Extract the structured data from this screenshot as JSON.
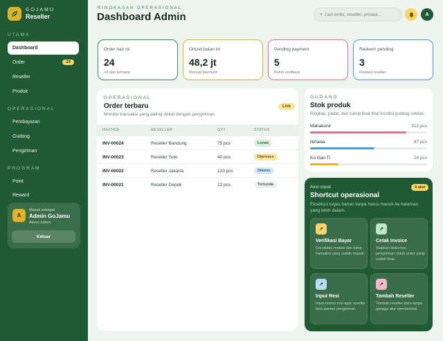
{
  "brand": {
    "top": "GOJAMU",
    "bottom": "Reseller"
  },
  "sidebar": {
    "sections": [
      {
        "label": "UTAMA"
      },
      {
        "label": "OPERASIONAL"
      },
      {
        "label": "PROGRAM"
      }
    ],
    "items": [
      {
        "label": "Dashboard"
      },
      {
        "label": "Order",
        "badge": "24"
      },
      {
        "label": "Reseller"
      },
      {
        "label": "Produk"
      },
      {
        "label": "Pembayaran"
      },
      {
        "label": "Gudang"
      },
      {
        "label": "Pengiriman"
      },
      {
        "label": "Point"
      },
      {
        "label": "Reward"
      }
    ],
    "user": {
      "caption": "Masuk sebagai",
      "name": "Admin GoJamu",
      "role": "Akses admin",
      "initial": "A",
      "logout": "Keluar"
    }
  },
  "header": {
    "eyebrow": "RINGKASAN OPERASIONAL",
    "title": "Dashboard Admin",
    "search_placeholder": "Cari order, reseller, produk...",
    "avatar_initial": "A"
  },
  "stats": [
    {
      "label": "Order hari ini",
      "value": "24",
      "note": "+8 dari kemarin",
      "color": "#3d8a58"
    },
    {
      "label": "Omzet bulan ini",
      "value": "48,2 jt",
      "note": "Manual payment",
      "color": "#e0b42a"
    },
    {
      "label": "Pending payment",
      "value": "5",
      "note": "Butuh verifikasi",
      "color": "#d9748f"
    },
    {
      "label": "Redeem pending",
      "value": "3",
      "note": "Reward reseller",
      "color": "#4a9bd1"
    }
  ],
  "orders": {
    "eyebrow": "OPERASIONAL",
    "title": "Order terbaru",
    "subtitle": "Monitor transaksi yang paling dekat dengan pengiriman.",
    "badge": "Live",
    "columns": [
      "INVOICE",
      "RESELLER",
      "QTY",
      "STATUS"
    ],
    "rows": [
      {
        "invoice": "INV-00024",
        "reseller": "Reseller Bandung",
        "qty": "75 pcs",
        "status": "Lunas",
        "bg": "#d6efdc",
        "fg": "#2b6a3f"
      },
      {
        "invoice": "INV-00023",
        "reseller": "Reseller Solo",
        "qty": "40 pcs",
        "status": "Diproses",
        "bg": "#f8e6a3",
        "fg": "#6b5208"
      },
      {
        "invoice": "INV-00022",
        "reseller": "Reseller Jakarta",
        "qty": "120 pcs",
        "status": "Dikirim",
        "bg": "#d6e9f8",
        "fg": "#1f5a85"
      },
      {
        "invoice": "INV-00021",
        "reseller": "Reseller Depok",
        "qty": "12 pcs",
        "status": "Tertunda",
        "bg": "#edf0ee",
        "fg": "#4b5850"
      }
    ]
  },
  "stock": {
    "eyebrow": "GUDANG",
    "title": "Stok produk",
    "subtitle": "Ringkas, padat, dan cukup buat lihat kondisi gudang sekilas.",
    "items": [
      {
        "name": "Mahakunir",
        "qty": "312 pcs",
        "level": 0.82,
        "color": "#d9748f"
      },
      {
        "name": "Nirlawa",
        "qty": "87 pcs",
        "level": 0.55,
        "color": "#4a9bd1"
      },
      {
        "name": "Ko Gan Ti",
        "qty": "24 pcs",
        "level": 0.24,
        "color": "#e0b42a"
      }
    ]
  },
  "shortcuts": {
    "eyebrow": "Aksi cepat",
    "badge": "4 aksi",
    "title": "Shortcut operasional",
    "subtitle": "Eksekusi tugas harian tanpa harus masuk ke halaman yang lebih dalam.",
    "tiles": [
      {
        "title": "Verifikasi Bayar",
        "desc": "Cocokkan mutasi dan tutup transaksi yang sudah masuk.",
        "color": "#f6d56a"
      },
      {
        "title": "Cetak Invoice",
        "desc": "Siapkan dokumen pengiriman untuk order yang sudah final.",
        "color": "#bfe6c8"
      },
      {
        "title": "Input Resi",
        "desc": "Input nomor resi agar reseller bisa pantau pengiriman.",
        "color": "#b9dcf5"
      },
      {
        "title": "Tambah Reseller",
        "desc": "Tambah reseller baru tanpa ganggu alur operasional.",
        "color": "#f3b9c8"
      }
    ],
    "icon_glyph": "↗"
  }
}
